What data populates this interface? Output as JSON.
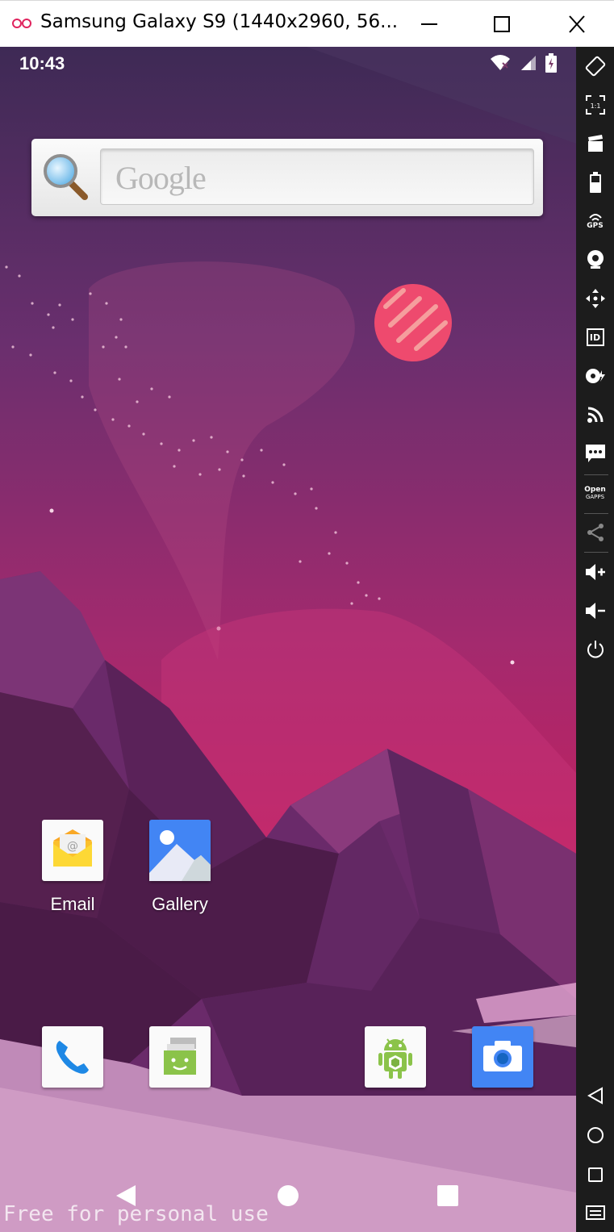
{
  "window": {
    "title": "Samsung Galaxy S9 (1440x2960, 56...",
    "controls": [
      "minimize-icon",
      "maximize-icon",
      "close-icon"
    ]
  },
  "statusbar": {
    "time": "10:43",
    "icons": [
      "wifi-off-icon",
      "cell-signal-icon",
      "battery-charging-icon"
    ]
  },
  "search_widget": {
    "placeholder": "Google",
    "icon": "magnifier-icon"
  },
  "apps": [
    {
      "name": "Email",
      "icon": "email-icon",
      "color": "#fbc02d"
    },
    {
      "name": "Gallery",
      "icon": "gallery-icon",
      "color": "#4285f4"
    }
  ],
  "dock": [
    {
      "icon": "phone-icon",
      "color": "#1e88e5"
    },
    {
      "icon": "messaging-icon",
      "color": "#8bc34a"
    },
    {
      "icon": "android-apk-icon",
      "color": "#8bc34a"
    },
    {
      "icon": "camera-icon",
      "color": "#4285f4"
    }
  ],
  "navbar": [
    "back-icon",
    "home-icon",
    "recents-icon"
  ],
  "toolbar": {
    "gps_label": "GPS",
    "id_label": "ID",
    "opengapps_line1": "Open",
    "opengapps_line2": "GAPPS",
    "scale_label": "1:1"
  },
  "watermark": "Free for personal use"
}
